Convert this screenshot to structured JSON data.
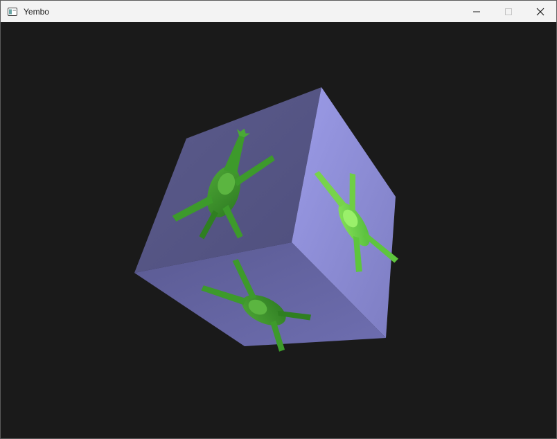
{
  "window": {
    "title": "Yembo",
    "app_icon": "window-icon",
    "controls": [
      {
        "name": "minimize",
        "icon": "minimize-icon"
      },
      {
        "name": "maximize",
        "icon": "maximize-icon",
        "enabled": false
      },
      {
        "name": "close",
        "icon": "close-icon"
      }
    ]
  },
  "viewport": {
    "background": "#1a1a1a",
    "scene": {
      "object": "textured-cube",
      "face_color": "#8c8ce0",
      "texture": "green-creature-model",
      "texture_color": "#3fa22e"
    }
  }
}
